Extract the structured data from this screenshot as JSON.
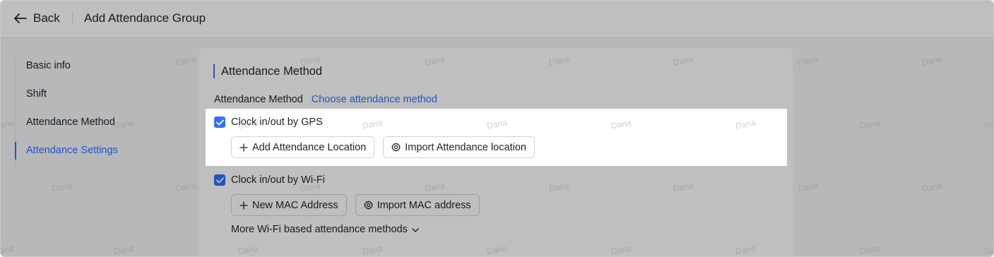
{
  "header": {
    "back_label": "Back",
    "title": "Add Attendance Group"
  },
  "sidebar": {
    "steps": [
      {
        "label": "Basic info",
        "active": false
      },
      {
        "label": "Shift",
        "active": false
      },
      {
        "label": "Attendance Method",
        "active": false
      },
      {
        "label": "Attendance Settings",
        "active": true
      }
    ]
  },
  "main": {
    "section_title": "Attendance Method",
    "method_label": "Attendance Method",
    "method_link": "Choose attendance method",
    "gps": {
      "label": "Clock in/out by GPS",
      "checked": true,
      "add_button": "Add Attendance Location",
      "import_button": "Import Attendance location"
    },
    "wifi": {
      "label": "Clock in/out by Wi-Fi",
      "checked": true,
      "add_button": "New MAC Address",
      "import_button": "Import MAC address",
      "more_link": "More Wi-Fi based attendance methods"
    }
  },
  "watermark": "Dana",
  "colors": {
    "accent": "#3370ff",
    "overlay": "rgba(0,0,0,0.25)",
    "page_bg": "#f5f6f7"
  }
}
